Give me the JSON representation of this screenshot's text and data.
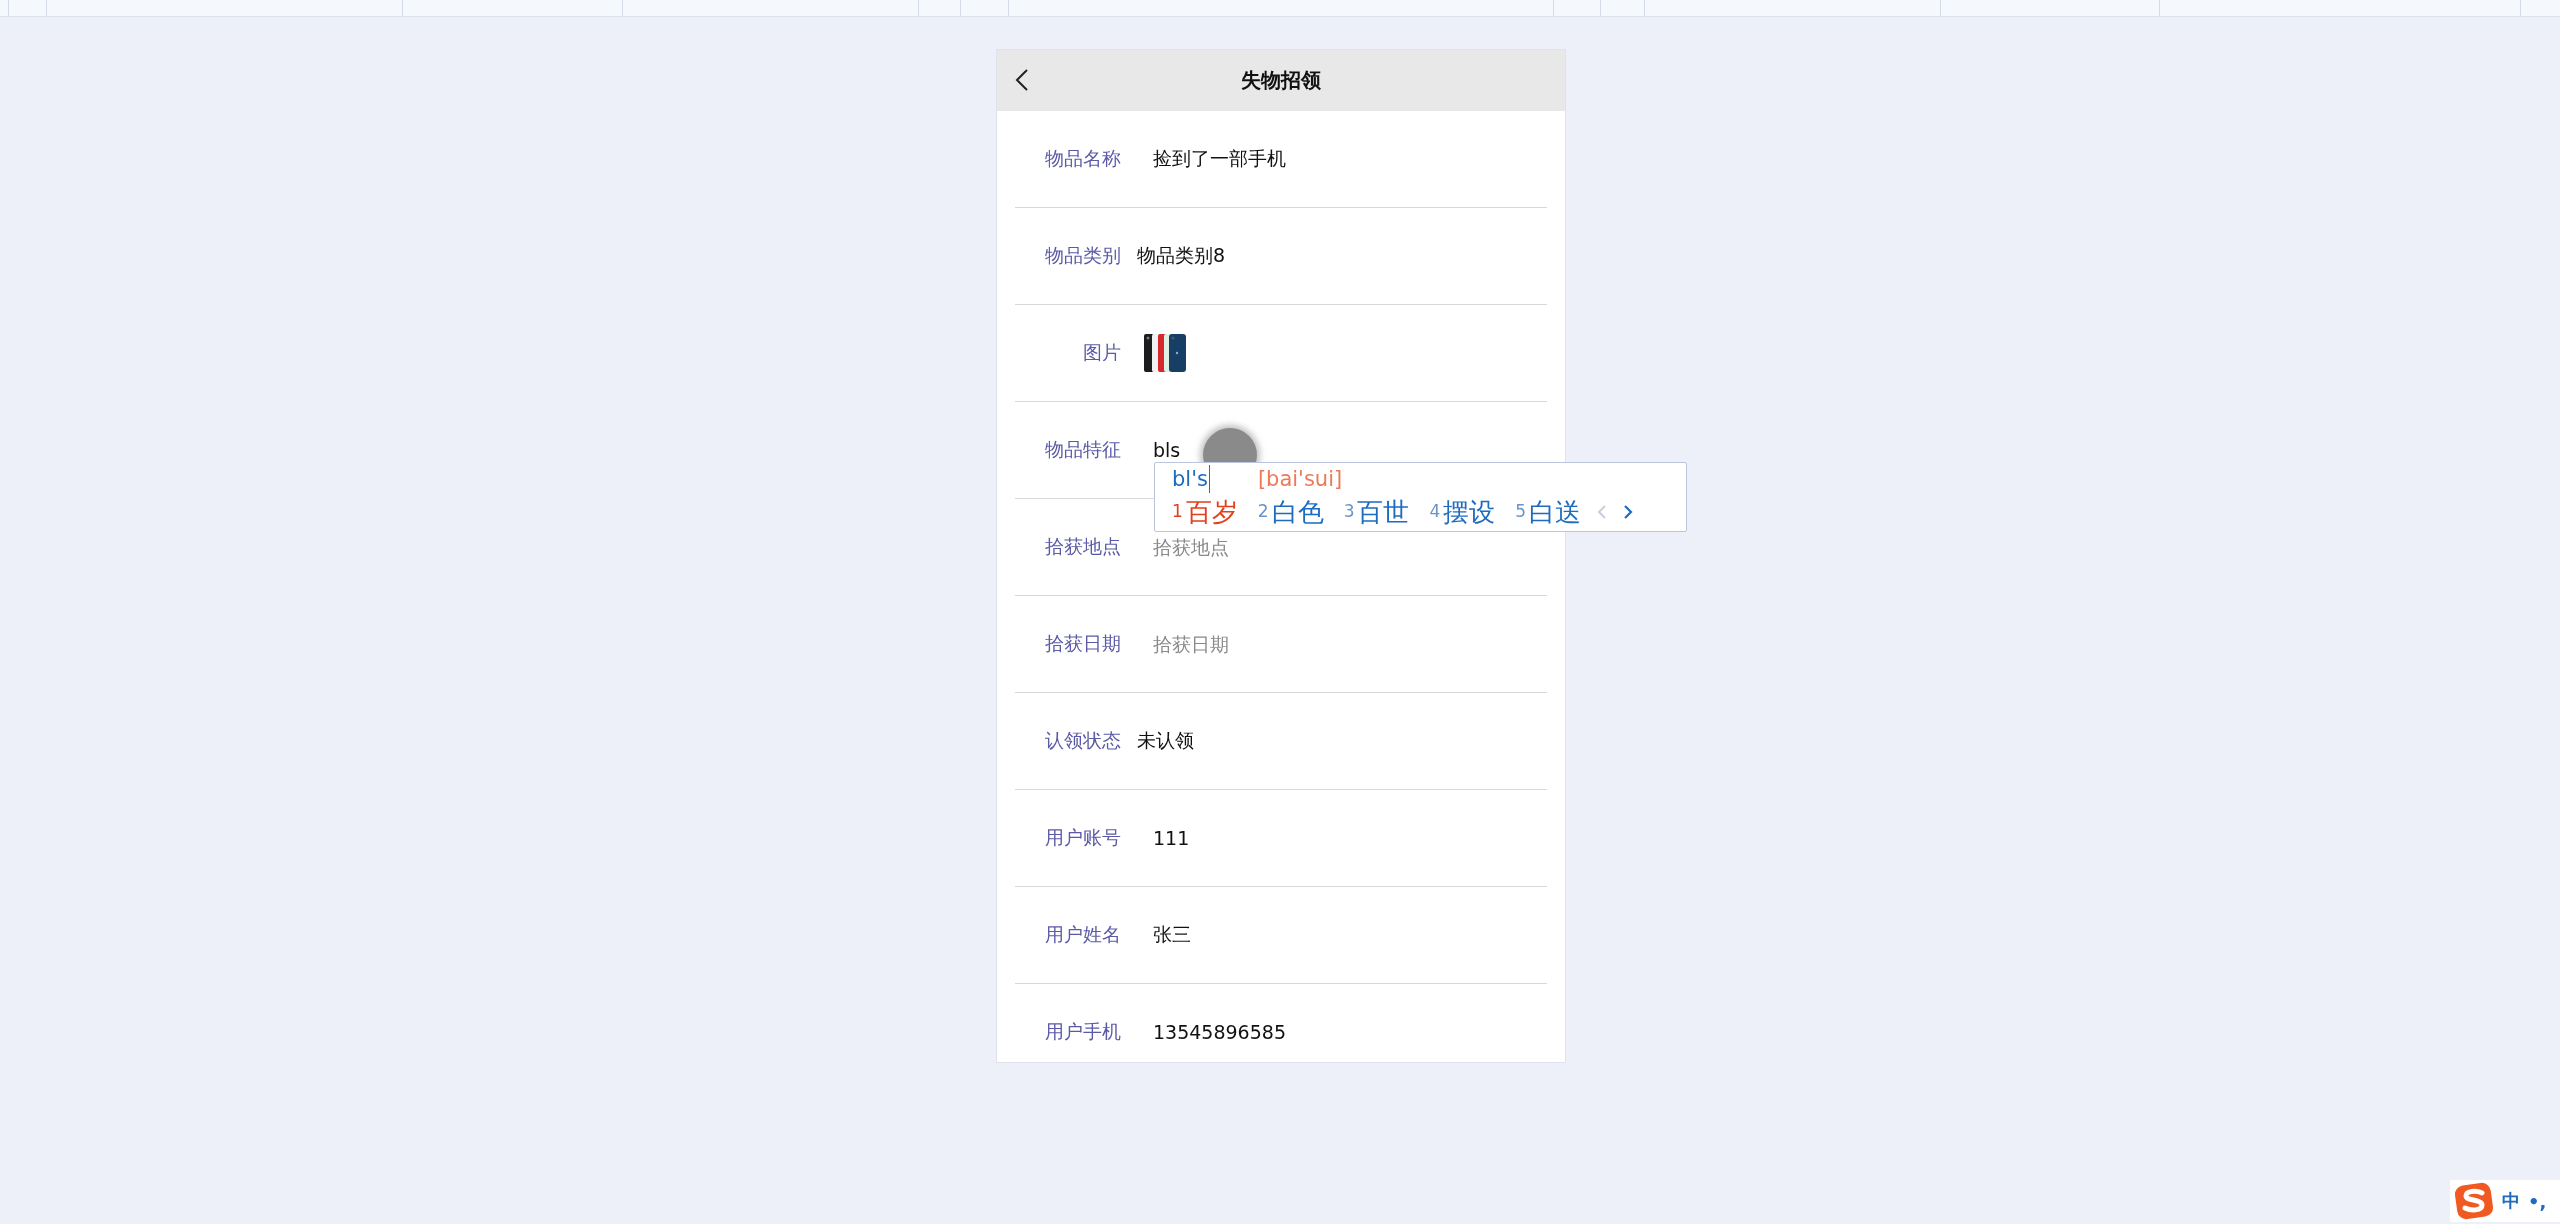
{
  "header": {
    "title": "失物招领"
  },
  "fields": [
    {
      "label": "物品名称",
      "kind": "input",
      "value": "捡到了一部手机"
    },
    {
      "label": "物品类别",
      "kind": "text",
      "value": "物品类别8"
    },
    {
      "label": "图片"
    },
    {
      "label": "物品特征",
      "kind": "input",
      "value": "bls"
    },
    {
      "label": "拾获地点",
      "kind": "input",
      "placeholder": "拾获地点"
    },
    {
      "label": "拾获日期",
      "kind": "input",
      "placeholder": "拾获日期"
    },
    {
      "label": "认领状态",
      "kind": "text",
      "value": "未认领"
    },
    {
      "label": "用户账号",
      "kind": "input",
      "value": "111"
    },
    {
      "label": "用户姓名",
      "kind": "input",
      "value": "张三"
    },
    {
      "label": "用户手机",
      "kind": "input",
      "value": "13545896585"
    }
  ],
  "ime": {
    "composition": "bl's",
    "pinyin": "[bai'sui]",
    "candidates": [
      {
        "index": "1",
        "text": "百岁",
        "selected": true
      },
      {
        "index": "2",
        "text": "白色",
        "selected": false
      },
      {
        "index": "3",
        "text": "百世",
        "selected": false
      },
      {
        "index": "4",
        "text": "摆设",
        "selected": false
      },
      {
        "index": "5",
        "text": "白送",
        "selected": false
      }
    ]
  },
  "ime_status": {
    "mode": "中",
    "punctuation": "•,"
  }
}
